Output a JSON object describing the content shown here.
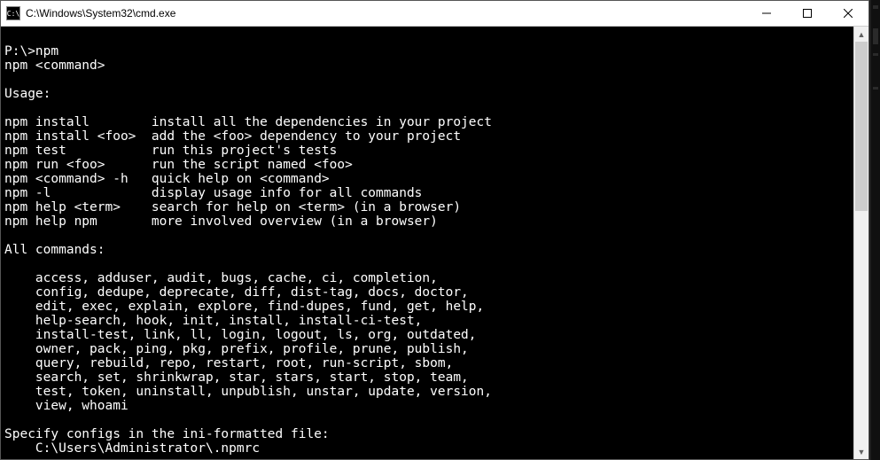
{
  "window": {
    "title": "C:\\Windows\\System32\\cmd.exe",
    "icon_label": "C:\\"
  },
  "controls": {
    "minimize": "Minimize",
    "maximize": "Maximize",
    "close": "Close"
  },
  "terminal": {
    "prompt_line": "P:\\>npm",
    "syntax_line": "npm <command>",
    "usage_header": "Usage:",
    "usage_rows": [
      {
        "cmd": "npm install",
        "desc": "install all the dependencies in your project"
      },
      {
        "cmd": "npm install <foo>",
        "desc": "add the <foo> dependency to your project"
      },
      {
        "cmd": "npm test",
        "desc": "run this project's tests"
      },
      {
        "cmd": "npm run <foo>",
        "desc": "run the script named <foo>"
      },
      {
        "cmd": "npm <command> -h",
        "desc": "quick help on <command>"
      },
      {
        "cmd": "npm -l",
        "desc": "display usage info for all commands"
      },
      {
        "cmd": "npm help <term>",
        "desc": "search for help on <term> (in a browser)"
      },
      {
        "cmd": "npm help npm",
        "desc": "more involved overview (in a browser)"
      }
    ],
    "all_header": "All commands:",
    "all_commands": [
      "    access, adduser, audit, bugs, cache, ci, completion,",
      "    config, dedupe, deprecate, diff, dist-tag, docs, doctor,",
      "    edit, exec, explain, explore, find-dupes, fund, get, help,",
      "    help-search, hook, init, install, install-ci-test,",
      "    install-test, link, ll, login, logout, ls, org, outdated,",
      "    owner, pack, ping, pkg, prefix, profile, prune, publish,",
      "    query, rebuild, repo, restart, root, run-script, sbom,",
      "    search, set, shrinkwrap, star, stars, start, stop, team,",
      "    test, token, uninstall, unpublish, unstar, update, version,",
      "    view, whoami"
    ],
    "config_header": "Specify configs in the ini-formatted file:",
    "config_path": "    C:\\Users\\Administrator\\.npmrc"
  }
}
